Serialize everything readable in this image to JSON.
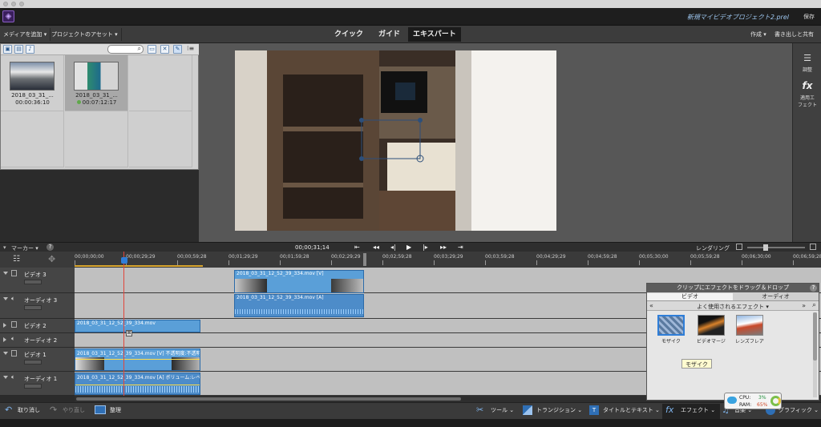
{
  "app": {
    "project_title": "新規マイビデオプロジェクト2.prel",
    "save_label": "保存",
    "logo_glyph": "◈"
  },
  "menu": {
    "add_media": "メディアを追加",
    "project_assets": "プロジェクトのアセット",
    "mode_tabs": [
      "クイック",
      "ガイド",
      "エキスパート"
    ],
    "active_mode": "エキスパート",
    "create": "作成",
    "export_share": "書き出しと共有"
  },
  "assets": {
    "items": [
      {
        "name": "2018_03_31_...",
        "duration": "00:00:36:10"
      },
      {
        "name": "2018_03_31_...",
        "duration": "00:07:12:17"
      }
    ]
  },
  "right_panel": {
    "adjust_label": "調整",
    "applied_fx_label": "適用エ\nフェクト"
  },
  "timeline": {
    "marker_label": "マーカー",
    "current_time": "00;00;31;14",
    "render_label": "レンダリング",
    "ruler_ticks": [
      "00;00;00;00",
      "00;00;29;29",
      "00;00;59;28",
      "00;01;29;29",
      "00;01;59;28",
      "00;02;29;29",
      "00;02;59;28",
      "00;03;29;29",
      "00;03;59;28",
      "00;04;29;29",
      "00;04;59;28",
      "00;05;30;00",
      "00;05;59;28",
      "00;06;30;00",
      "00;06;59;28"
    ],
    "tracks": [
      {
        "name": "ビデオ 3",
        "kind": "video"
      },
      {
        "name": "オーディオ 3",
        "kind": "audio"
      },
      {
        "name": "ビデオ 2",
        "kind": "video"
      },
      {
        "name": "オーディオ 2",
        "kind": "audio"
      },
      {
        "name": "ビデオ 1",
        "kind": "video"
      },
      {
        "name": "オーディオ 1",
        "kind": "audio"
      }
    ],
    "clips": {
      "v3": "2018_03_31_12_52_39_334.mov [V]",
      "a3": "2018_03_31_12_52_39_334.mov [A]",
      "v2": "2018_03_31_12_52_39_334.mov",
      "v1": "2018_03_31_12_52_39_334.mov [V] 不透明度:不透明度 ▾",
      "a1": "2018_03_31_12_52_39_334.mov [A] ボリューム:レベル ▾"
    }
  },
  "bottom_bar": {
    "undo": "取り消し",
    "redo": "やり直し",
    "organize": "整理",
    "tools": "ツール",
    "transitions": "トランジション",
    "titles": "タイトルとテキスト",
    "effects": "エフェクト",
    "music": "音楽",
    "graphics": "グラフィック"
  },
  "effects_panel": {
    "title": "クリップにエフェクトをドラッグ＆ドロップ",
    "tabs": [
      "ビデオ",
      "オーディオ"
    ],
    "active_tab": "ビデオ",
    "category": "よく使用されるエフェクト",
    "items": [
      "モザイク",
      "ビデオマージ",
      "レンズフレア"
    ],
    "tooltip": "モザイク"
  },
  "cpu_widget": {
    "cpu_label": "CPU:",
    "cpu_value": "3%",
    "ram_label": "RAM:",
    "ram_value": "65%"
  },
  "colors": {
    "clip_blue": "#5a9fd8",
    "playhead": "#e0453c",
    "selected_blue": "#2f7ed8"
  }
}
